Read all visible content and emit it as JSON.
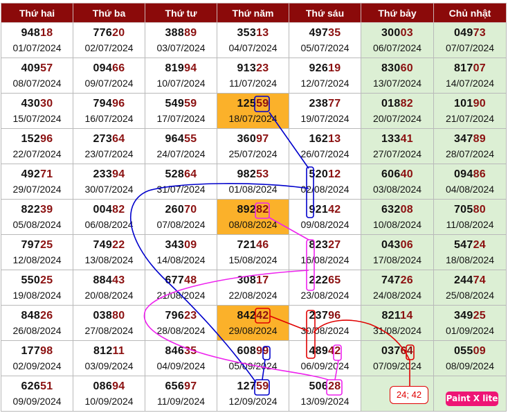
{
  "headers": [
    "Thứ hai",
    "Thứ ba",
    "Thứ tư",
    "Thứ năm",
    "Thứ sáu",
    "Thứ bảy",
    "Chủ nhật"
  ],
  "rows": [
    [
      {
        "p": "948",
        "s": "18",
        "d": "01/07/2024"
      },
      {
        "p": "776",
        "s": "20",
        "d": "02/07/2024"
      },
      {
        "p": "388",
        "s": "89",
        "d": "03/07/2024"
      },
      {
        "p": "353",
        "s": "13",
        "d": "04/07/2024"
      },
      {
        "p": "497",
        "s": "35",
        "d": "05/07/2024"
      },
      {
        "p": "300",
        "s": "03",
        "d": "06/07/2024"
      },
      {
        "p": "049",
        "s": "73",
        "d": "07/07/2024"
      }
    ],
    [
      {
        "p": "409",
        "s": "57",
        "d": "08/07/2024"
      },
      {
        "p": "094",
        "s": "66",
        "d": "09/07/2024"
      },
      {
        "p": "819",
        "s": "94",
        "d": "10/07/2024"
      },
      {
        "p": "913",
        "s": "23",
        "d": "11/07/2024"
      },
      {
        "p": "926",
        "s": "19",
        "d": "12/07/2024"
      },
      {
        "p": "830",
        "s": "60",
        "d": "13/07/2024"
      },
      {
        "p": "817",
        "s": "07",
        "d": "14/07/2024"
      }
    ],
    [
      {
        "p": "430",
        "s": "30",
        "d": "15/07/2024"
      },
      {
        "p": "794",
        "s": "96",
        "d": "16/07/2024"
      },
      {
        "p": "549",
        "s": "59",
        "d": "17/07/2024"
      },
      {
        "p": "125",
        "s": "59",
        "d": "18/07/2024",
        "hl": true
      },
      {
        "p": "238",
        "s": "77",
        "d": "19/07/2024"
      },
      {
        "p": "018",
        "s": "82",
        "d": "20/07/2024"
      },
      {
        "p": "101",
        "s": "90",
        "d": "21/07/2024"
      }
    ],
    [
      {
        "p": "152",
        "s": "96",
        "d": "22/07/2024"
      },
      {
        "p": "273",
        "s": "64",
        "d": "23/07/2024"
      },
      {
        "p": "964",
        "s": "55",
        "d": "24/07/2024"
      },
      {
        "p": "360",
        "s": "97",
        "d": "25/07/2024"
      },
      {
        "p": "162",
        "s": "13",
        "d": "26/07/2024"
      },
      {
        "p": "133",
        "s": "41",
        "d": "27/07/2024"
      },
      {
        "p": "347",
        "s": "89",
        "d": "28/07/2024"
      }
    ],
    [
      {
        "p": "492",
        "s": "71",
        "d": "29/07/2024"
      },
      {
        "p": "233",
        "s": "94",
        "d": "30/07/2024"
      },
      {
        "p": "528",
        "s": "64",
        "d": "31/07/2024"
      },
      {
        "p": "982",
        "s": "53",
        "d": "01/08/2024"
      },
      {
        "p": "520",
        "s": "12",
        "d": "02/08/2024"
      },
      {
        "p": "606",
        "s": "40",
        "d": "03/08/2024"
      },
      {
        "p": "094",
        "s": "86",
        "d": "04/08/2024"
      }
    ],
    [
      {
        "p": "822",
        "s": "39",
        "d": "05/08/2024"
      },
      {
        "p": "004",
        "s": "82",
        "d": "06/08/2024"
      },
      {
        "p": "260",
        "s": "70",
        "d": "07/08/2024"
      },
      {
        "p": "892",
        "s": "82",
        "d": "08/08/2024",
        "hl": true
      },
      {
        "p": "921",
        "s": "42",
        "d": "09/08/2024"
      },
      {
        "p": "632",
        "s": "08",
        "d": "10/08/2024"
      },
      {
        "p": "705",
        "s": "80",
        "d": "11/08/2024"
      }
    ],
    [
      {
        "p": "797",
        "s": "25",
        "d": "12/08/2024"
      },
      {
        "p": "749",
        "s": "22",
        "d": "13/08/2024"
      },
      {
        "p": "343",
        "s": "09",
        "d": "14/08/2024"
      },
      {
        "p": "721",
        "s": "46",
        "d": "15/08/2024"
      },
      {
        "p": "823",
        "s": "27",
        "d": "16/08/2024"
      },
      {
        "p": "043",
        "s": "06",
        "d": "17/08/2024"
      },
      {
        "p": "547",
        "s": "24",
        "d": "18/08/2024"
      }
    ],
    [
      {
        "p": "550",
        "s": "25",
        "d": "19/08/2024"
      },
      {
        "p": "884",
        "s": "43",
        "d": "20/08/2024"
      },
      {
        "p": "677",
        "s": "48",
        "d": "21/08/2024"
      },
      {
        "p": "308",
        "s": "17",
        "d": "22/08/2024"
      },
      {
        "p": "222",
        "s": "65",
        "d": "23/08/2024"
      },
      {
        "p": "747",
        "s": "26",
        "d": "24/08/2024"
      },
      {
        "p": "244",
        "s": "74",
        "d": "25/08/2024"
      }
    ],
    [
      {
        "p": "848",
        "s": "26",
        "d": "26/08/2024"
      },
      {
        "p": "038",
        "s": "80",
        "d": "27/08/2024"
      },
      {
        "p": "796",
        "s": "23",
        "d": "28/08/2024"
      },
      {
        "p": "842",
        "s": "42",
        "d": "29/08/2024",
        "hl": true
      },
      {
        "p": "237",
        "s": "96",
        "d": "30/08/2024"
      },
      {
        "p": "821",
        "s": "14",
        "d": "31/08/2024"
      },
      {
        "p": "349",
        "s": "25",
        "d": "01/09/2024"
      }
    ],
    [
      {
        "p": "177",
        "s": "98",
        "d": "02/09/2024"
      },
      {
        "p": "812",
        "s": "11",
        "d": "03/09/2024"
      },
      {
        "p": "846",
        "s": "35",
        "d": "04/09/2024"
      },
      {
        "p": "608",
        "s": "99",
        "d": "05/09/2024"
      },
      {
        "p": "489",
        "s": "42",
        "d": "06/09/2024"
      },
      {
        "p": "037",
        "s": "64",
        "d": "07/09/2024"
      },
      {
        "p": "055",
        "s": "09",
        "d": "08/09/2024"
      }
    ],
    [
      {
        "p": "626",
        "s": "51",
        "d": "09/09/2024"
      },
      {
        "p": "086",
        "s": "94",
        "d": "10/09/2024"
      },
      {
        "p": "656",
        "s": "97",
        "d": "11/09/2024"
      },
      {
        "p": "127",
        "s": "59",
        "d": "12/09/2024"
      },
      {
        "p": "506",
        "s": "28",
        "d": "13/09/2024"
      },
      {
        "empty": true
      },
      {
        "empty": true
      }
    ]
  ],
  "annotation_note": "24; 42",
  "watermark": "Paint X lite",
  "colors": {
    "header_bg": "#8b0a0a",
    "weekend_bg": "#dcefd4",
    "highlight_bg": "#fbb12a",
    "suffix": "#8b1010",
    "blue": "#0000cc",
    "magenta": "#ee22ee",
    "red": "#e00000",
    "badge": "#ee1575"
  }
}
